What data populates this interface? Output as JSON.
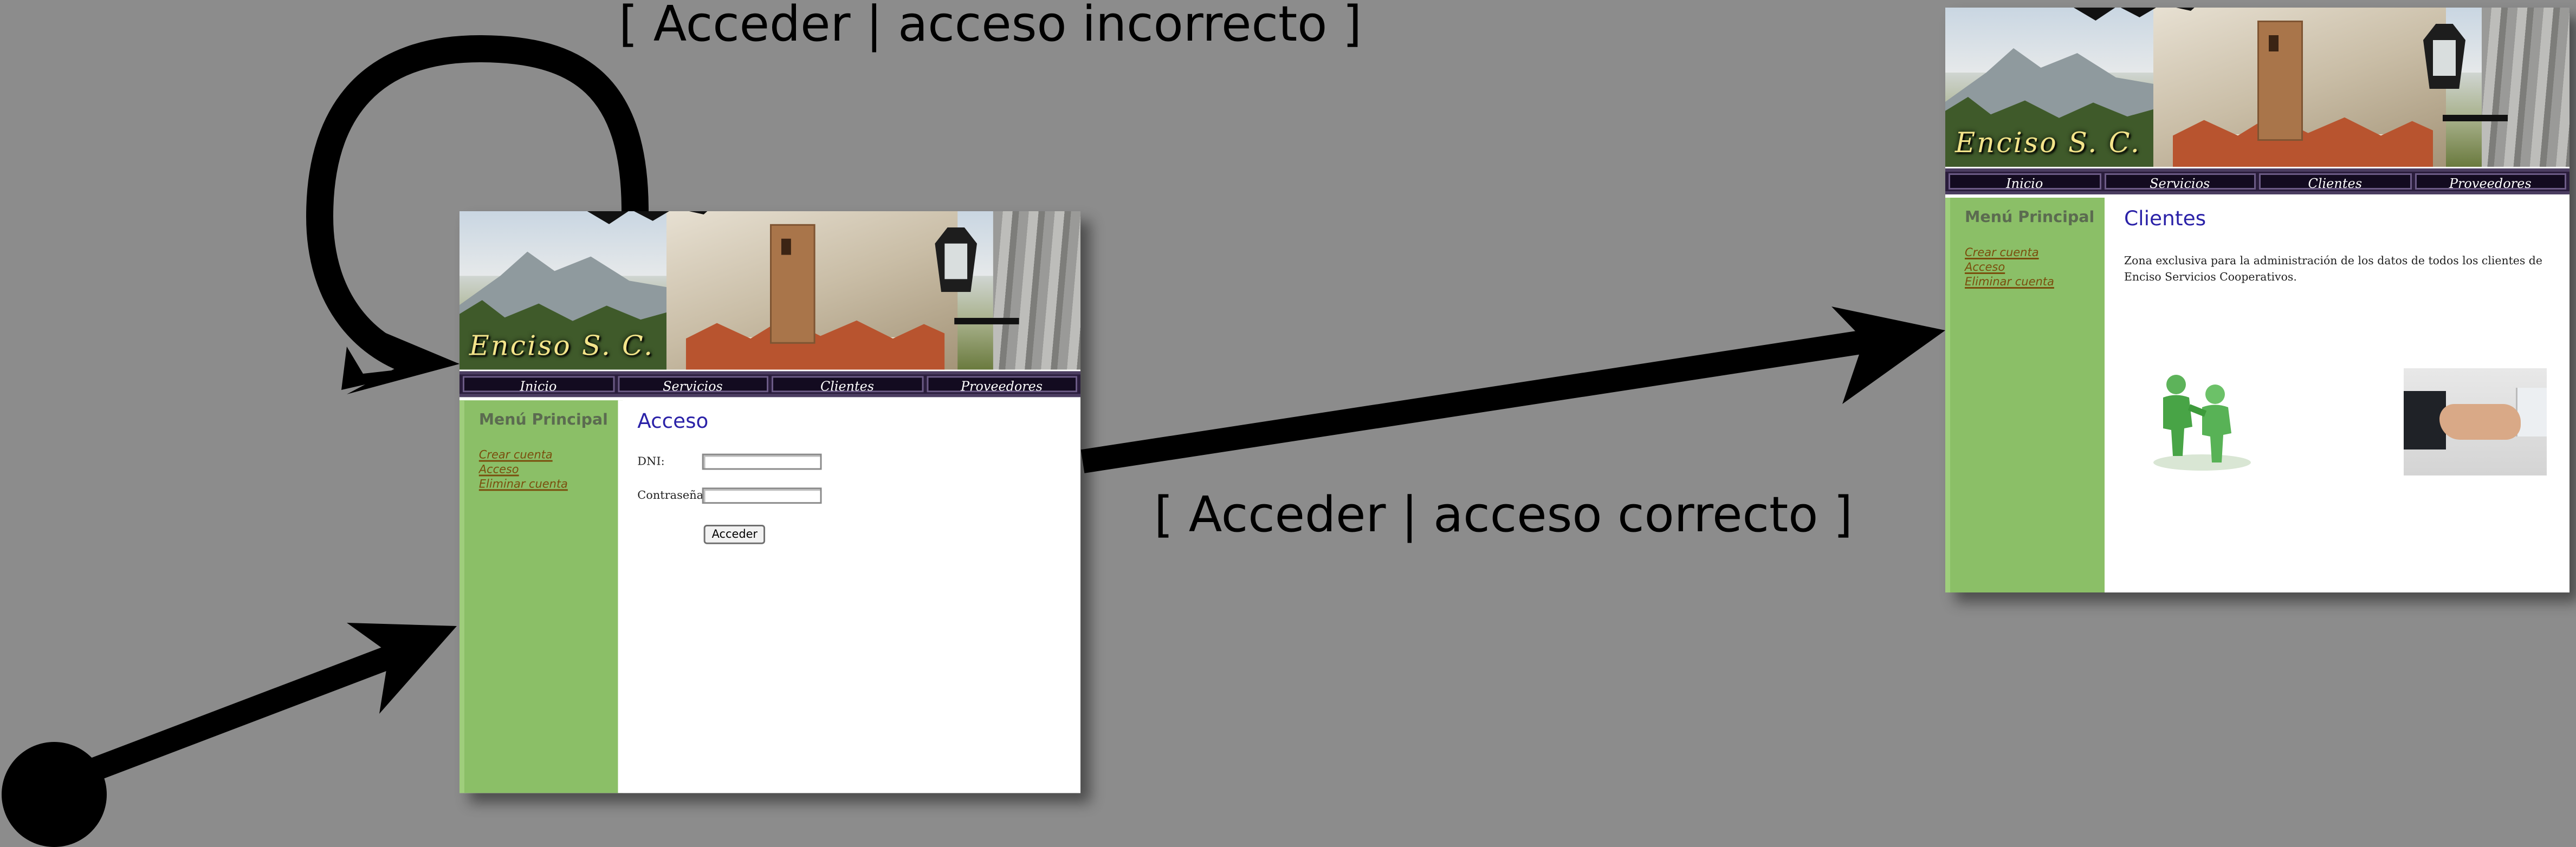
{
  "transitions": {
    "self_loop_label": "[ Acceder | acceso incorrecto ]",
    "success_label": "[ Acceder | acceso correcto ]"
  },
  "login_page": {
    "banner_brand": "Enciso S. C.",
    "nav": [
      "Inicio",
      "Servicios",
      "Clientes",
      "Proveedores"
    ],
    "sidebar_title": "Menú Principal",
    "sidebar_links": [
      "Crear cuenta",
      "Acceso",
      "Eliminar cuenta"
    ],
    "title": "Acceso",
    "dni_label": "DNI:",
    "password_label": "Contraseña:",
    "submit_label": "Acceder"
  },
  "clients_page": {
    "banner_brand": "Enciso S. C.",
    "nav": [
      "Inicio",
      "Servicios",
      "Clientes",
      "Proveedores"
    ],
    "sidebar_title": "Menú Principal",
    "sidebar_links": [
      "Crear cuenta",
      "Acceso",
      "Eliminar cuenta"
    ],
    "title": "Clientes",
    "description": "Zona exclusiva para la administración de los datos de todos los clientes de Enciso Servicios Cooperativos."
  },
  "colors": {
    "background": "#8c8c8c",
    "sidebar": "#8bbf67",
    "title": "#2b22a8",
    "navbar": "#130b20"
  }
}
